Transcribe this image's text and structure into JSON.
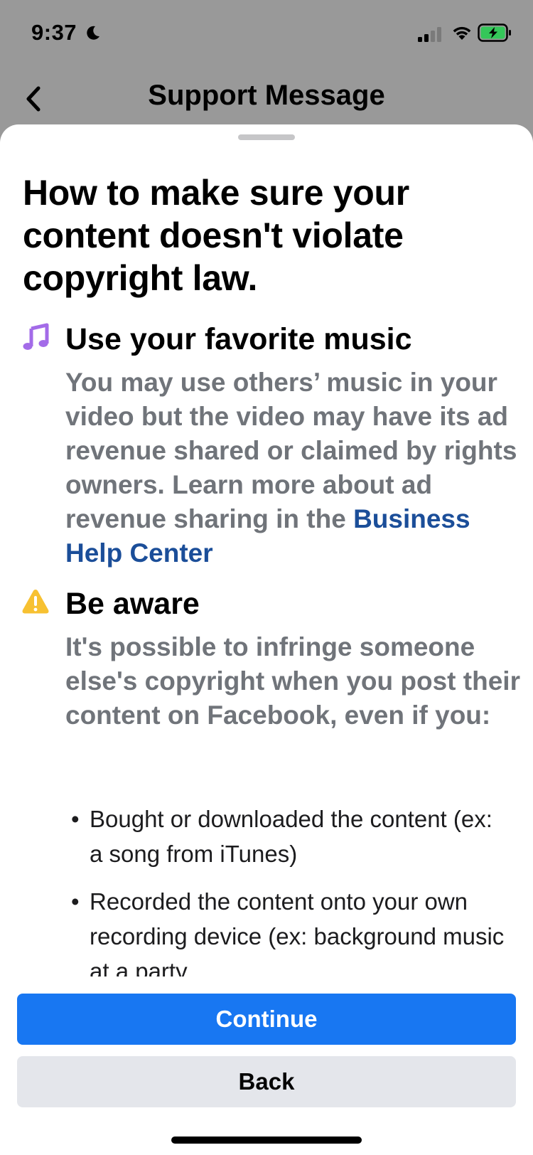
{
  "status_bar": {
    "time": "9:37"
  },
  "nav": {
    "title": "Support Message"
  },
  "content": {
    "heading": "How to make sure your content doesn't violate copyright law.",
    "music_section": {
      "icon": "music-note-icon",
      "title": "Use your favorite music",
      "body_text": "You may use others’ music in your video but the video may have its ad revenue shared or claimed by rights owners. Learn more about ad revenue sharing in the ",
      "link_text": "Business Help Center"
    },
    "aware_section": {
      "icon": "warning-icon",
      "title": "Be aware",
      "body_text": "It's possible to infringe someone else's copyright when you post their content on Facebook, even if you:",
      "bullets": [
        "Bought or downloaded the content (ex: a song from iTunes)",
        "Recorded the content onto your own recording device (ex: background music at a party"
      ]
    }
  },
  "buttons": {
    "continue_label": "Continue",
    "back_label": "Back"
  },
  "colors": {
    "primary": "#1877f2",
    "link": "#1b4e99",
    "music_icon": "#a36be8",
    "warning_icon": "#f7c131",
    "battery_fill": "#34c759"
  }
}
